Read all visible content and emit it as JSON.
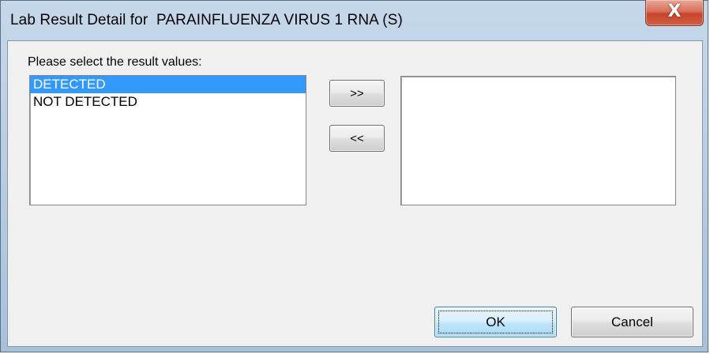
{
  "window": {
    "title": "Lab Result Detail for  PARAINFLUENZA VIRUS 1 RNA (S)",
    "close_glyph": "X"
  },
  "dialog": {
    "prompt": "Please select the result values:",
    "available_values": [
      {
        "label": "DETECTED",
        "selected": true
      },
      {
        "label": "NOT DETECTED",
        "selected": false
      }
    ],
    "selected_values": [],
    "add_button_label": ">>",
    "remove_button_label": "<<",
    "ok_label": "OK",
    "cancel_label": "Cancel"
  },
  "colors": {
    "selection": "#3399ff",
    "close_button": "#c7442a"
  }
}
